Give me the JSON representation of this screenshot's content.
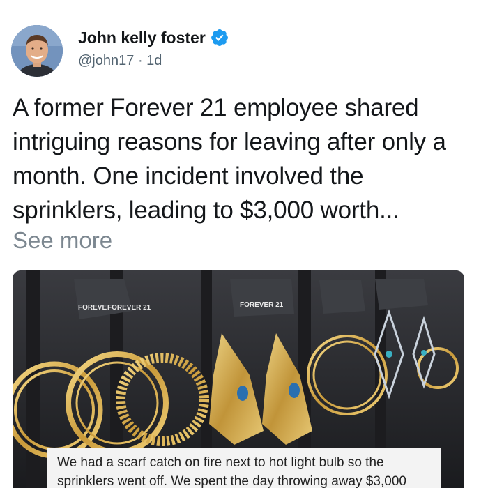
{
  "author": {
    "name": "John kelly foster",
    "handle": "@john17",
    "separator": "·",
    "time": "1d",
    "verified_icon": "verified-badge-icon"
  },
  "tweet": {
    "text": "A former Forever 21 employee shared intriguing reasons for leaving after only a month. One incident involved the sprinklers, leading to $3,000 worth...",
    "see_more": "See more"
  },
  "media": {
    "caption_line1": "We had a scarf catch on fire next to hot light bulb so the",
    "caption_line2": "sprinklers went off. We spent the day throwing away $3,000",
    "tags": [
      "FOREVE",
      "FOREVER 21",
      "FOREVER 21"
    ]
  },
  "colors": {
    "verified": "#1d9bf0",
    "muted": "#536471",
    "see_more": "#7c8790"
  }
}
